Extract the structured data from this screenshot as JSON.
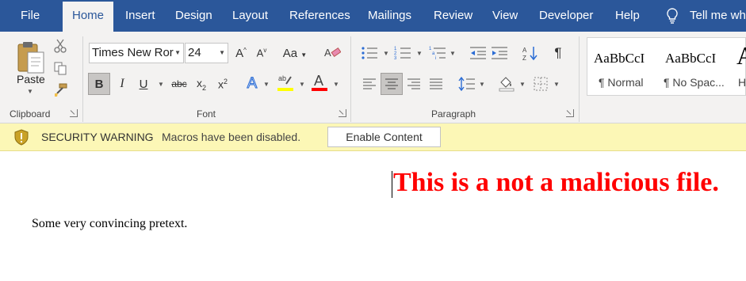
{
  "tabs": [
    "File",
    "Home",
    "Insert",
    "Design",
    "Layout",
    "References",
    "Mailings",
    "Review",
    "View",
    "Developer",
    "Help"
  ],
  "tell_me": "Tell me wh",
  "clipboard": {
    "paste_label": "Paste",
    "group_label": "Clipboard"
  },
  "font": {
    "name": "Times New Ror",
    "size": "24",
    "group_label": "Font"
  },
  "paragraph": {
    "group_label": "Paragraph"
  },
  "styles": [
    {
      "sample": "AaBbCcI",
      "name": "¶ Normal"
    },
    {
      "sample": "AaBbCcI",
      "name": "¶ No Spac..."
    },
    {
      "sample": "A",
      "name": "H"
    }
  ],
  "security_bar": {
    "title": "SECURITY WARNING",
    "message": "Macros have been disabled.",
    "button": "Enable Content"
  },
  "document": {
    "heading": "This is a not a malicious file.",
    "body": "Some very convincing pretext."
  },
  "colors": {
    "tabbar": "#2b579a",
    "heading": "#ff0000",
    "highlight": "#ffff00",
    "font_color": "#ff0000",
    "warning_bar": "#fcf7b6"
  }
}
